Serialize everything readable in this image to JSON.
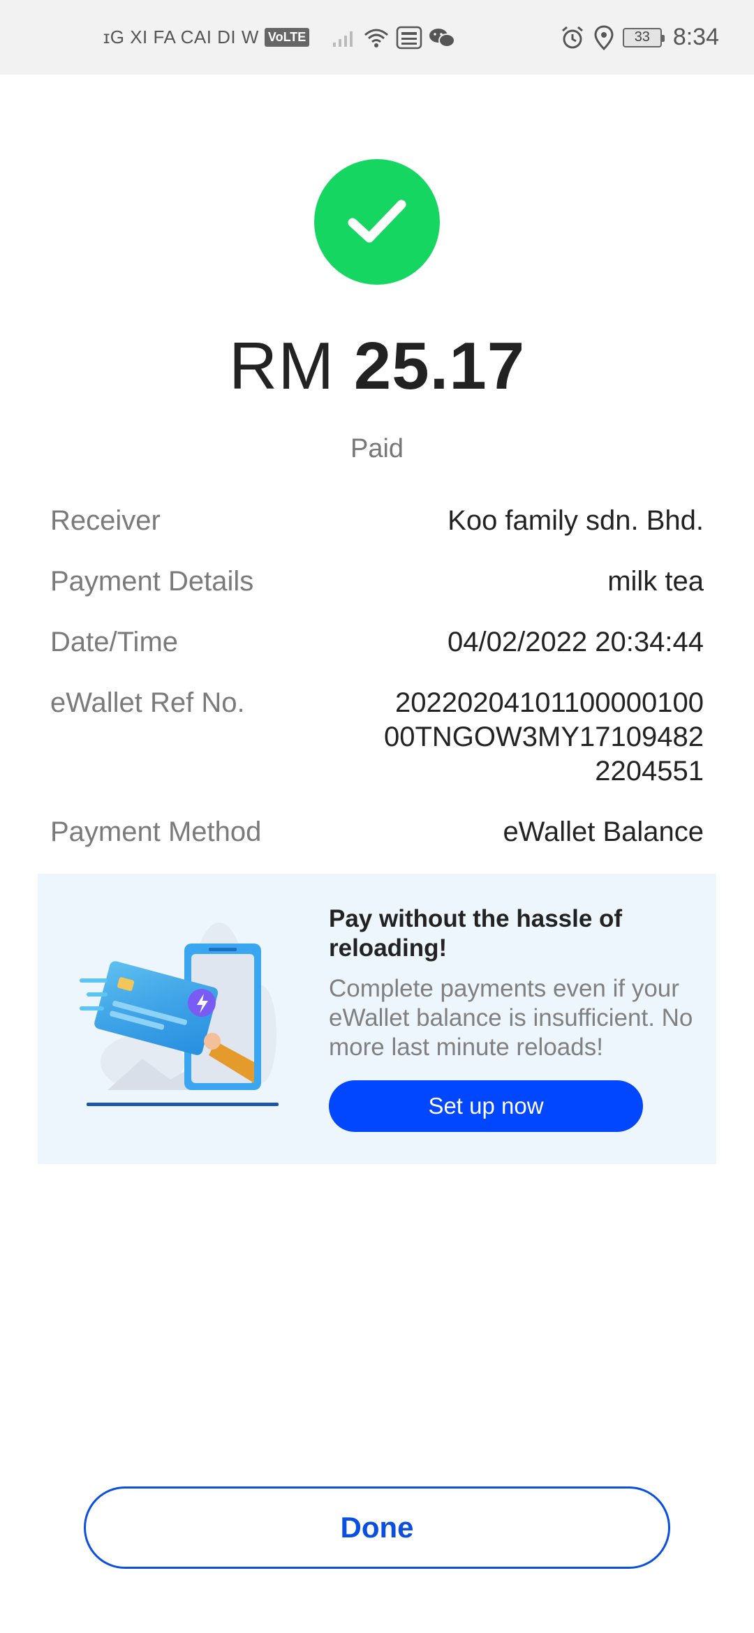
{
  "status_bar": {
    "ticker": "ɪG XI FA CAI DI W",
    "volte": "VoLTE",
    "battery": "33",
    "time": "8:34"
  },
  "payment": {
    "currency": "RM",
    "amount": "25.17",
    "status": "Paid"
  },
  "details": [
    {
      "label": "Receiver",
      "value": "Koo family sdn. Bhd."
    },
    {
      "label": "Payment Details",
      "value": "milk tea"
    },
    {
      "label": "Date/Time",
      "value": "04/02/2022 20:34:44"
    },
    {
      "label": "eWallet Ref No.",
      "value": "20220204101100000100 00TNGOW3MY171094822204551"
    },
    {
      "label": "Payment Method",
      "value": "eWallet Balance"
    }
  ],
  "promo": {
    "title": "Pay without the hassle of reloading!",
    "description": "Complete payments even if your eWallet balance is insufficient. No more last minute reloads!",
    "button": "Set up now"
  },
  "done_button": "Done",
  "colors": {
    "success": "#15d660",
    "primary": "#0047ff",
    "promo_bg": "#edf5fd"
  },
  "icons": [
    "signal-icon",
    "wifi-icon",
    "touch-n-go-icon",
    "wechat-icon",
    "alarm-icon",
    "location-icon",
    "battery-icon",
    "check-icon"
  ]
}
